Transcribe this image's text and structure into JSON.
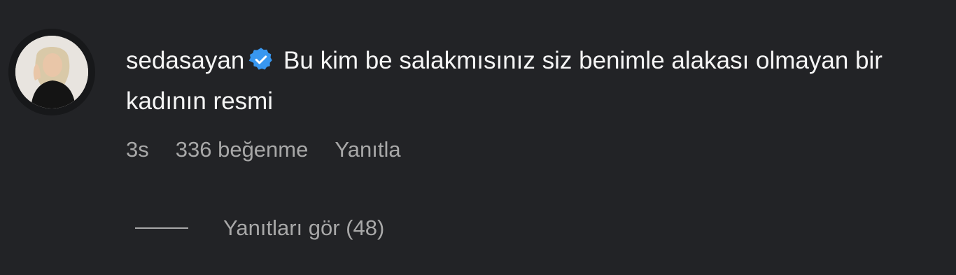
{
  "comment": {
    "username": "sedasayan",
    "verified": true,
    "text": "Bu kim be salakmısınız siz benimle alakası olmayan bir kadının resmi",
    "time": "3s",
    "likes": "336 beğenme",
    "reply_label": "Yanıtla",
    "view_replies_label": "Yanıtları gör (48)"
  },
  "colors": {
    "background": "#222326",
    "primary_text": "#f5f5f5",
    "secondary_text": "#a8a8a8",
    "verified_badge": "#3897f0"
  },
  "icons": {
    "avatar": "user-avatar",
    "verified": "verified-badge-icon"
  }
}
